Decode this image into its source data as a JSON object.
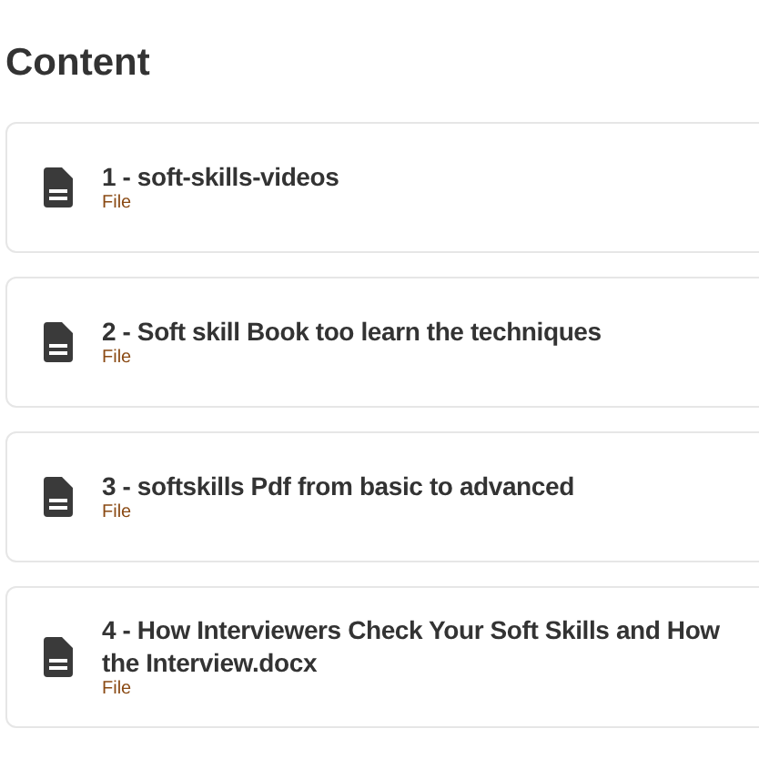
{
  "heading": "Content",
  "items": [
    {
      "title": "1 - soft-skills-videos",
      "type": "File"
    },
    {
      "title": "2 - Soft skill Book too learn the techniques",
      "type": "File"
    },
    {
      "title": "3 - softskills Pdf from basic to advanced",
      "type": "File"
    },
    {
      "title": "4 - How Interviewers Check Your Soft Skills and How the Interview.docx",
      "type": "File"
    }
  ]
}
